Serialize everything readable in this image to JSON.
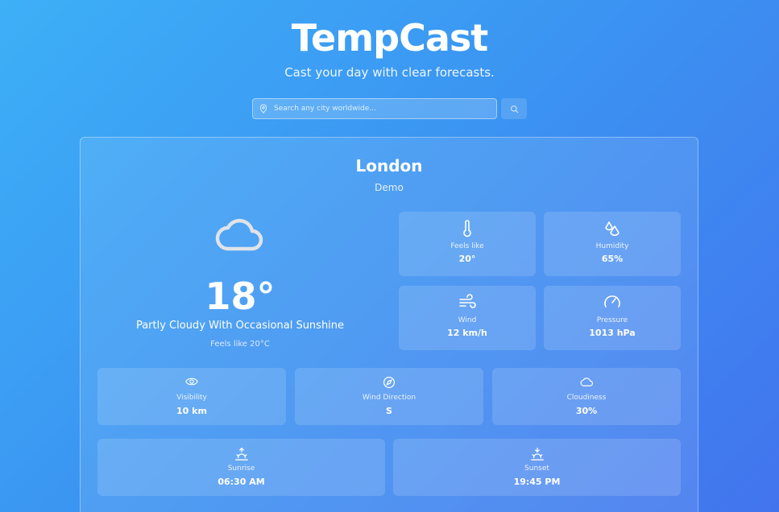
{
  "header": {
    "title": "TempCast",
    "tagline": "Cast your day with clear forecasts."
  },
  "search": {
    "placeholder": "Search any city worldwide...",
    "value": "",
    "pin_icon": "map-pin-icon",
    "button_icon": "search-icon"
  },
  "current": {
    "city": "London",
    "country": "Demo",
    "icon": "cloud-icon",
    "temperature": "18°",
    "description": "Partly Cloudy With Occasional Sunshine",
    "feels_like_text": "Feels like 20°C"
  },
  "details": [
    {
      "icon": "thermometer-icon",
      "label": "Feels like",
      "value": "20°"
    },
    {
      "icon": "droplets-icon",
      "label": "Humidity",
      "value": "65%"
    },
    {
      "icon": "wind-icon",
      "label": "Wind",
      "value": "12 km/h"
    },
    {
      "icon": "gauge-icon",
      "label": "Pressure",
      "value": "1013 hPa"
    }
  ],
  "extras": [
    {
      "icon": "eye-icon",
      "label": "Visibility",
      "value": "10 km"
    },
    {
      "icon": "compass-icon",
      "label": "Wind Direction",
      "value": "S"
    },
    {
      "icon": "cloud-icon",
      "label": "Cloudiness",
      "value": "30%"
    }
  ],
  "sun": [
    {
      "icon": "sunrise-icon",
      "label": "Sunrise",
      "value": "06:30 AM"
    },
    {
      "icon": "sunset-icon",
      "label": "Sunset",
      "value": "19:45 PM"
    }
  ]
}
